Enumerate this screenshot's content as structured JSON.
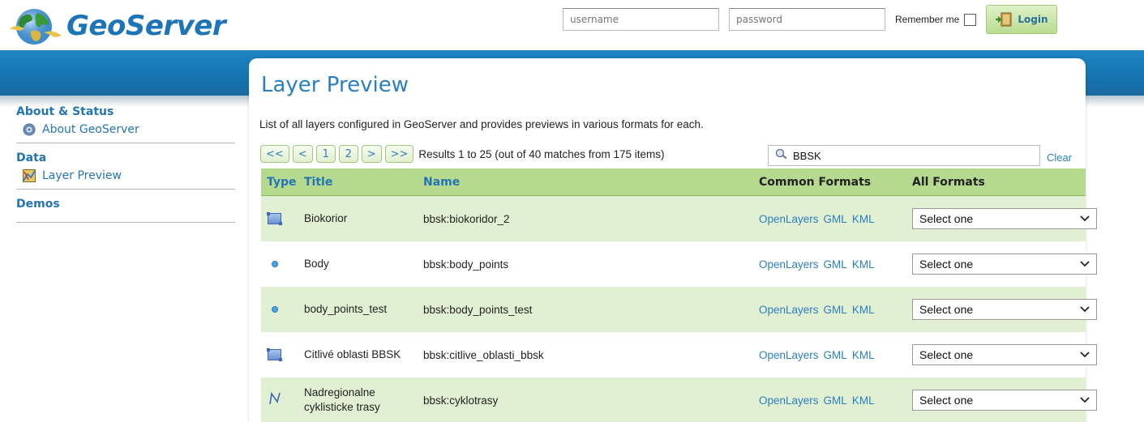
{
  "app": {
    "name": "GeoServer"
  },
  "login": {
    "username_placeholder": "username",
    "password_placeholder": "password",
    "remember_label": "Remember me",
    "login_label": "Login"
  },
  "sidebar": {
    "sections": [
      {
        "heading": "About & Status",
        "items": [
          {
            "label": "About GeoServer",
            "icon": "info-icon"
          }
        ]
      },
      {
        "heading": "Data",
        "items": [
          {
            "label": "Layer Preview",
            "icon": "map-icon"
          }
        ]
      },
      {
        "heading": "Demos",
        "items": []
      }
    ]
  },
  "page": {
    "title": "Layer Preview",
    "description": "List of all layers configured in GeoServer and provides previews in various formats for each."
  },
  "pager": {
    "first": "<<",
    "prev": "<",
    "pages": [
      "1",
      "2"
    ],
    "current_page": "1",
    "next": ">",
    "last": ">>",
    "info": "Results 1 to 25 (out of 40 matches from 175 items)"
  },
  "search": {
    "value": "BBSK",
    "clear_label": "Clear"
  },
  "table": {
    "headers": {
      "type": "Type",
      "title": "Title",
      "name": "Name",
      "common": "Common Formats",
      "all": "All Formats"
    },
    "common_formats": [
      "OpenLayers",
      "GML",
      "KML"
    ],
    "select_placeholder": "Select one",
    "rows": [
      {
        "type": "polygon",
        "title": "Biokorior",
        "name": "bbsk:biokoridor_2"
      },
      {
        "type": "point",
        "title": "Body",
        "name": "bbsk:body_points"
      },
      {
        "type": "point",
        "title": "body_points_test",
        "name": "bbsk:body_points_test"
      },
      {
        "type": "polygon",
        "title": "Citlivé oblasti BBSK",
        "name": "bbsk:citlive_oblasti_bbsk"
      },
      {
        "type": "line",
        "title": "Nadregionalne cyklisticke trasy",
        "name": "bbsk:cyklotrasy"
      }
    ]
  },
  "colors": {
    "accent": "#2a7fc0",
    "band": "#1570ad",
    "header_row": "#b5d98e",
    "row_alt": "#e1efd2"
  }
}
